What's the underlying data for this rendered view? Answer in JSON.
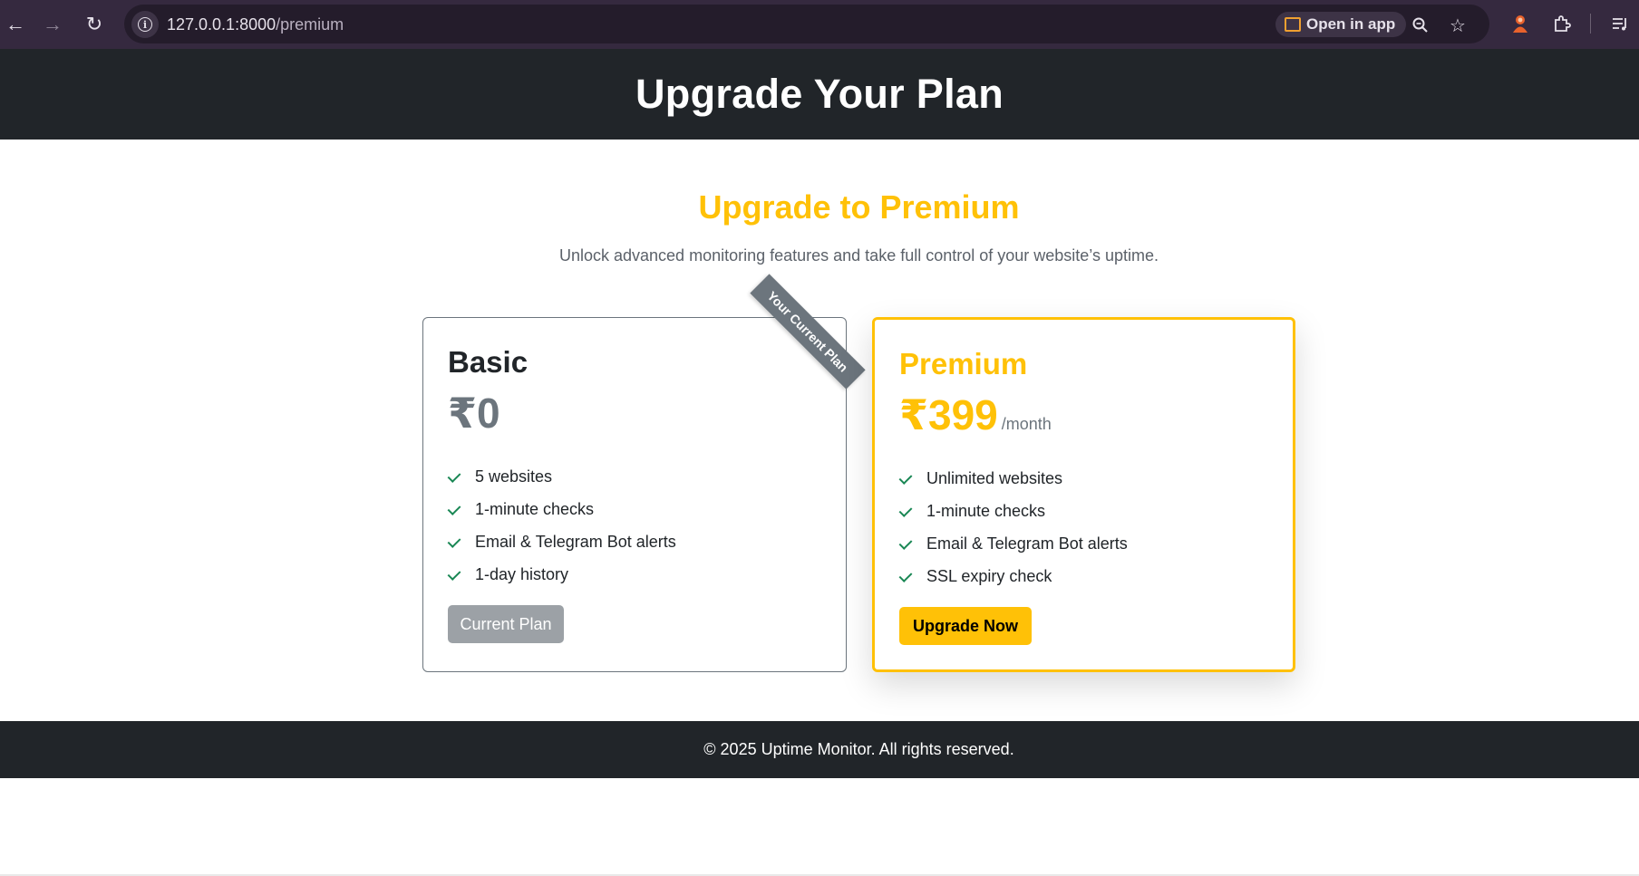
{
  "browser": {
    "url_host": "127.0.0.1:8000",
    "url_path": "/premium",
    "open_in_app_label": "Open in app",
    "icons": [
      "back-arrow-icon",
      "forward-arrow-icon",
      "reload-icon",
      "site-info-icon",
      "zoom-icon",
      "star-icon",
      "extension-avatar-icon",
      "puzzle-icon",
      "reading-list-icon"
    ]
  },
  "header": {
    "title": "Upgrade Your Plan"
  },
  "main": {
    "title": "Upgrade to Premium",
    "subtitle": "Unlock advanced monitoring features and take full control of your website’s uptime."
  },
  "plans": {
    "basic": {
      "name": "Basic",
      "price": "₹0",
      "ribbon": "Your Current Plan",
      "features": [
        "5 websites",
        "1-minute checks",
        "Email & Telegram Bot alerts",
        "1-day history"
      ],
      "button_label": "Current Plan"
    },
    "premium": {
      "name": "Premium",
      "price": "₹399",
      "period": "/month",
      "features": [
        "Unlimited websites",
        "1-minute checks",
        "Email & Telegram Bot alerts",
        "SSL expiry check"
      ],
      "button_label": "Upgrade Now"
    }
  },
  "footer": {
    "text": "© 2025 Uptime Monitor. All rights reserved."
  },
  "colors": {
    "accent": "#ffc107",
    "dark": "#212529",
    "muted": "#6c757d",
    "success": "#198754"
  }
}
